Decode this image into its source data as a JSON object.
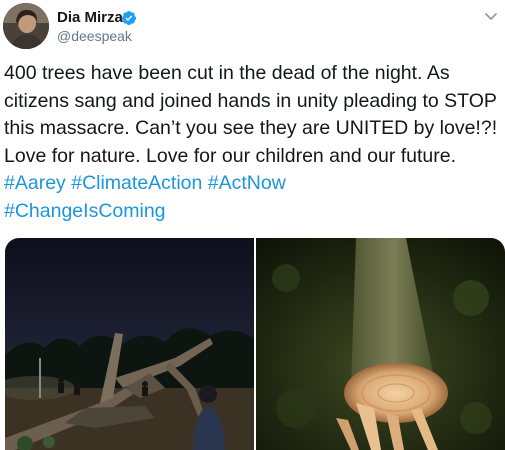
{
  "tweet": {
    "author": {
      "name": "Dia Mirza",
      "handle": "@deespeak",
      "verified": true
    },
    "text_segments": [
      "400 trees have been cut in the dead of the night. As citizens sang and joined hands in unity pleading to STOP this massacre. Can’t you see they are UNITED by love!?! Love for nature. Love for our children and our future. "
    ],
    "hashtags": [
      "#Aarey",
      "#ClimateAction",
      "#ActNow",
      "#ChangeIsComing"
    ],
    "media_count": 2
  },
  "colors": {
    "link": "#1b95e0",
    "verified": "#1da1f2",
    "text": "#14171a",
    "secondary": "#657786"
  },
  "icons": {
    "verified": "verified-badge-icon",
    "menu": "chevron-down-icon"
  }
}
